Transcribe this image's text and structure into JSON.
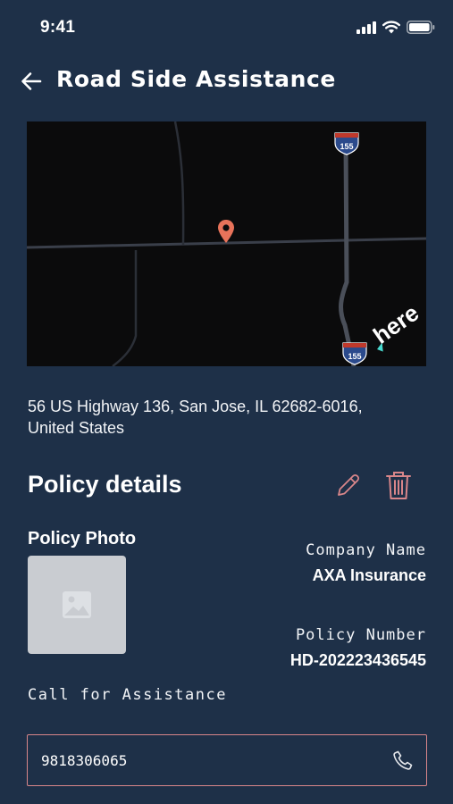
{
  "status_bar": {
    "time": "9:41"
  },
  "header": {
    "title": "Road Side Assistance"
  },
  "map": {
    "shield_top": "155",
    "shield_bottom": "155",
    "logo": "here",
    "pin_color": "#e8735a"
  },
  "address": {
    "line1": "56 US Highway 136, San Jose, IL 62682-6016,",
    "line2": "United States"
  },
  "policy": {
    "section_title": "Policy details",
    "photo_label": "Policy Photo",
    "company_label": "Company Name",
    "company_value": "AXA Insurance",
    "number_label": "Policy Number",
    "number_value": "HD-202223436545"
  },
  "assistance": {
    "label": "Call for Assistance",
    "phone": "9818306065"
  },
  "colors": {
    "background": "#1e3048",
    "accent": "#d9868a"
  }
}
